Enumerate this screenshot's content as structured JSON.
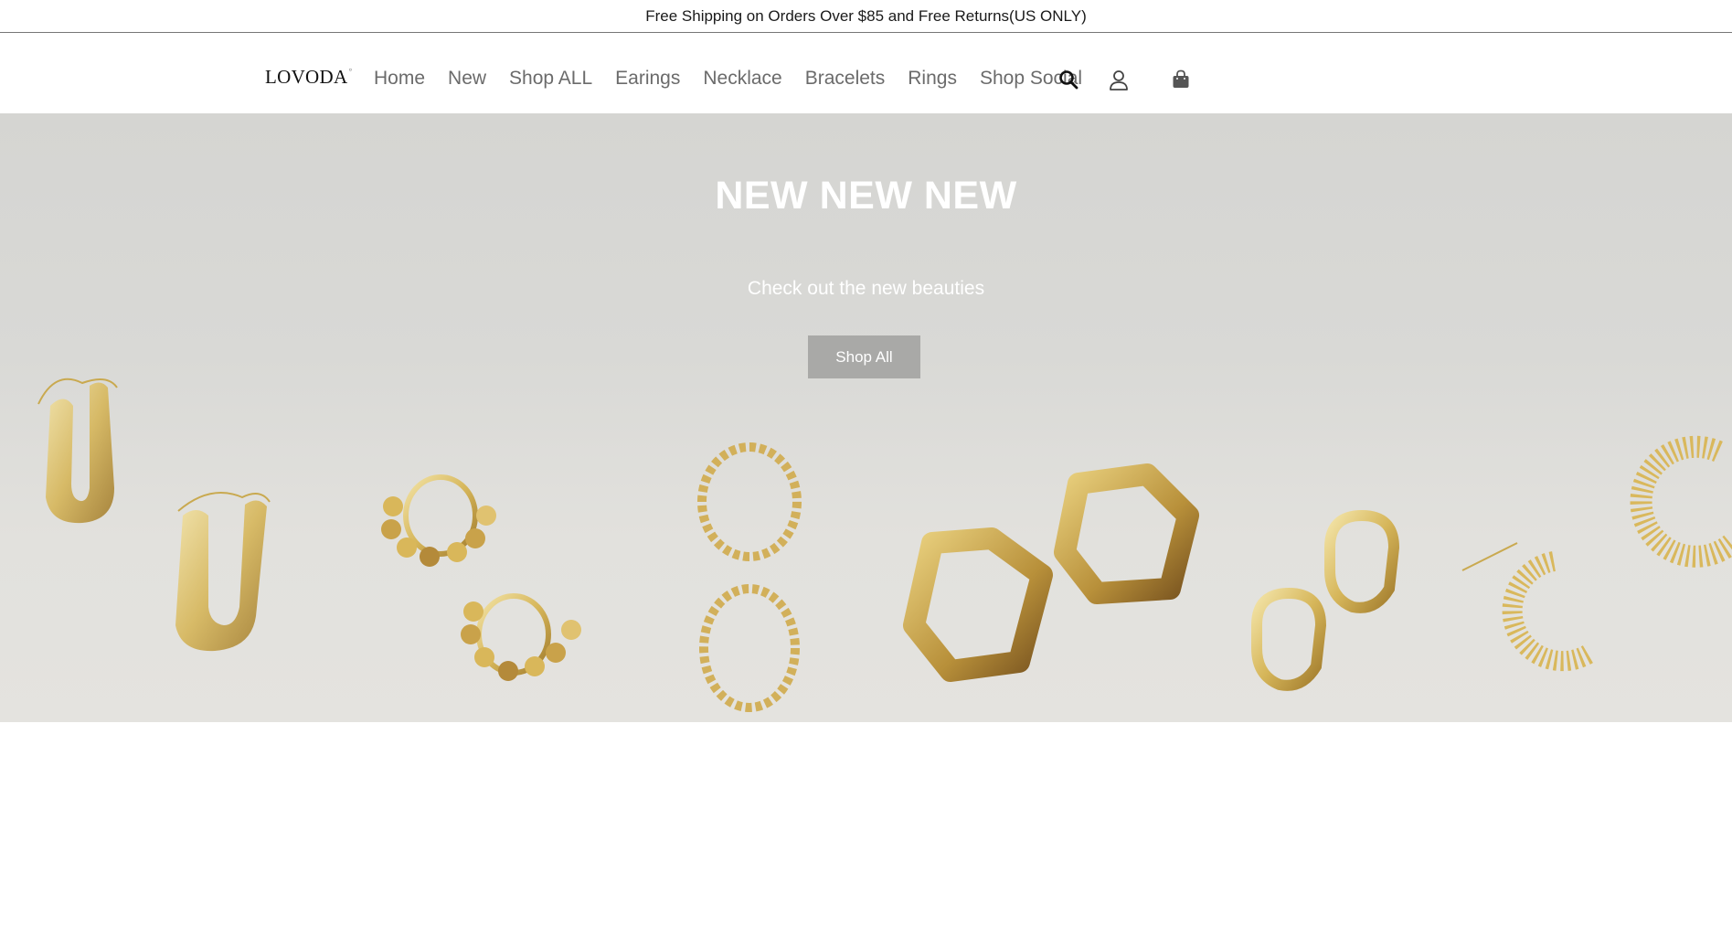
{
  "announcement": "Free Shipping on Orders Over $85 and Free Returns(US ONLY)",
  "brand": {
    "name": "LOVODA"
  },
  "nav": {
    "items": [
      {
        "label": "Home"
      },
      {
        "label": "New"
      },
      {
        "label": "Shop ALL"
      },
      {
        "label": "Earings"
      },
      {
        "label": "Necklace"
      },
      {
        "label": "Bracelets"
      },
      {
        "label": "Rings"
      },
      {
        "label": "Shop Social"
      }
    ],
    "icons": [
      "search-icon",
      "account-icon",
      "cart-bag-icon"
    ]
  },
  "hero": {
    "title": "NEW NEW NEW",
    "subtitle": "Check out the new beauties",
    "cta_label": "Shop All",
    "image_subject": "gold-earrings"
  },
  "colors": {
    "hero_bg": "#d9d9d6",
    "cta_bg": "#a9a9a7",
    "nav_text": "#6b6b6b",
    "gold": "#d8b758"
  }
}
